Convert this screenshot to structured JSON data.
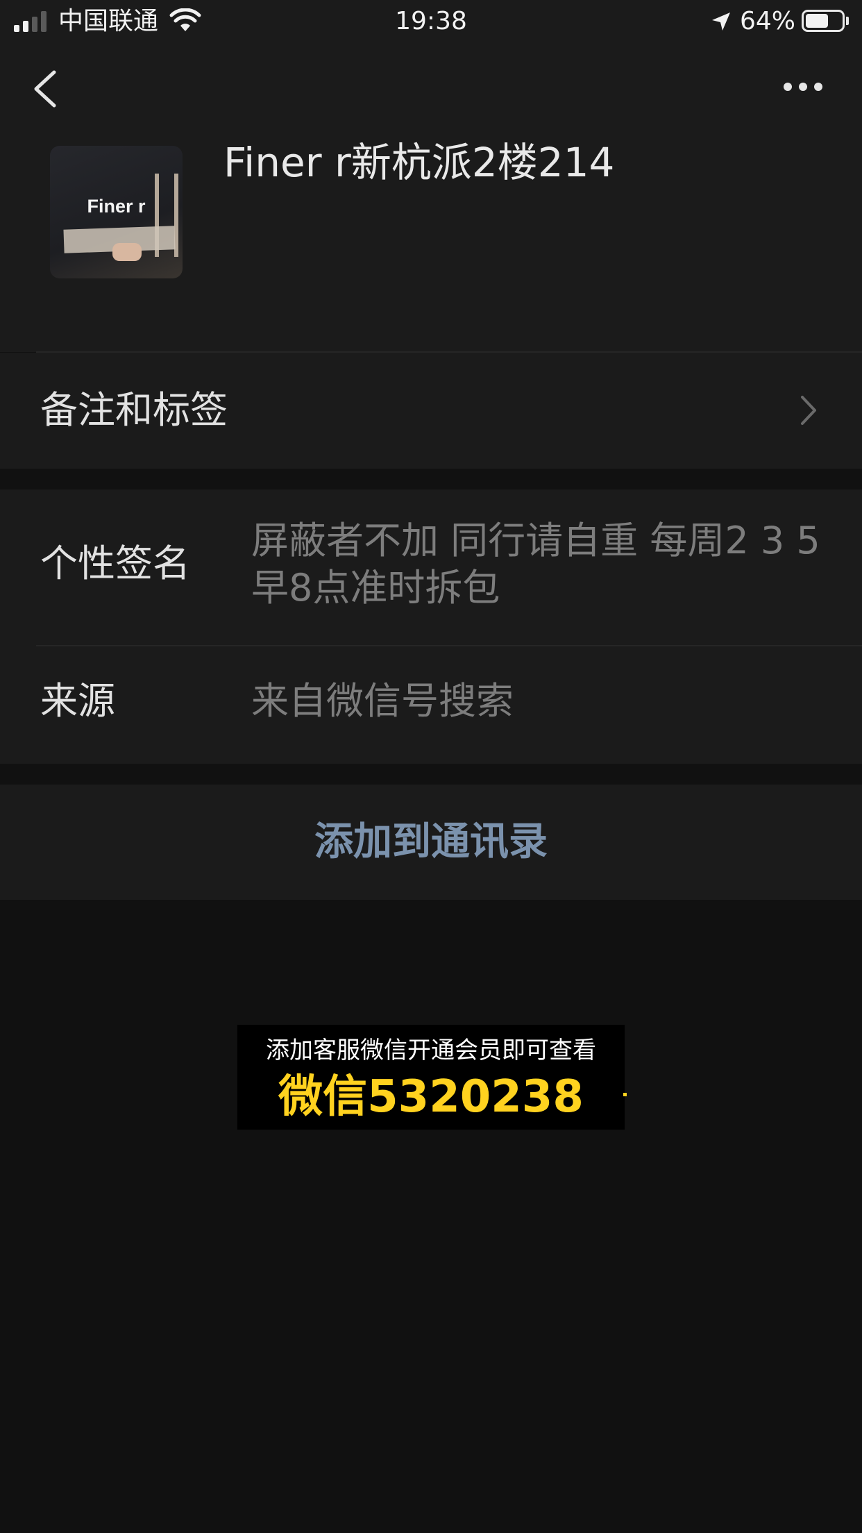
{
  "status_bar": {
    "carrier": "中国联通",
    "time": "19:38",
    "battery_percent": "64%",
    "battery_level": 0.64,
    "signal_bars": 2,
    "icons": [
      "signal-icon",
      "wifi-icon",
      "location-arrow-icon",
      "battery-icon"
    ]
  },
  "nav": {
    "icons": [
      "back-icon",
      "more-icon"
    ]
  },
  "profile": {
    "avatar_text": "Finer r",
    "name": "Finer r新杭派2楼214"
  },
  "rows": {
    "remarks_label": "备注和标签",
    "signature_label": "个性签名",
    "signature_value": "屏蔽者不加 同行请自重 每周2 3 5 早8点准时拆包",
    "source_label": "来源",
    "source_value": "来自微信号搜索"
  },
  "actions": {
    "add_contact": "添加到通讯录"
  },
  "overlay": {
    "line1": "添加客服微信开通会员即可查看",
    "line2": "微信5320238"
  },
  "colors": {
    "background": "#111111",
    "cell": "#1b1b1b",
    "link": "#7b92ad",
    "overlay_text": "#ffd21f"
  }
}
